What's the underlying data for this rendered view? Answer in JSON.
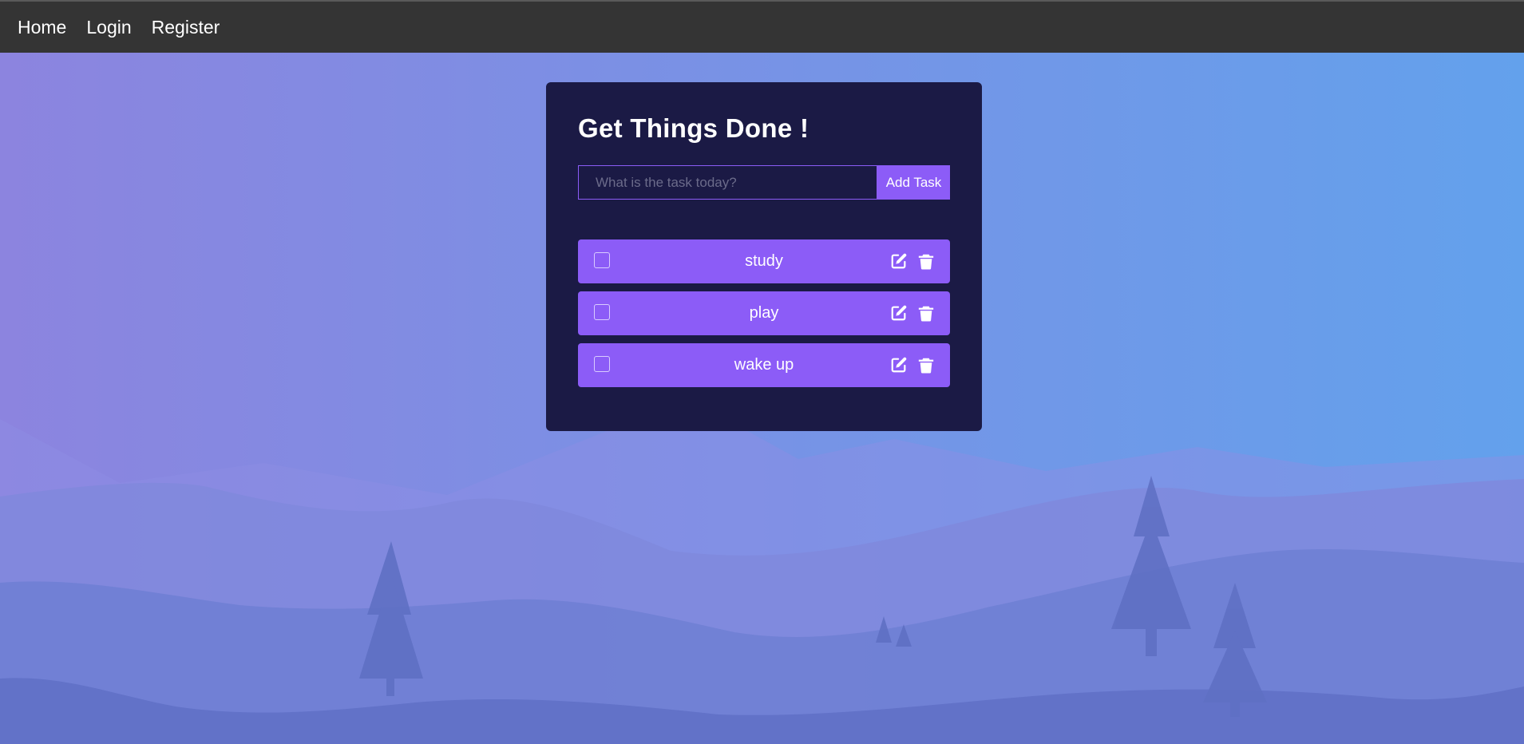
{
  "nav": {
    "links": [
      "Home",
      "Login",
      "Register"
    ]
  },
  "todo": {
    "title": "Get Things Done !",
    "input_placeholder": "What is the task today?",
    "input_value": "",
    "add_button_label": "Add Task",
    "tasks": [
      {
        "text": "study",
        "completed": false
      },
      {
        "text": "play",
        "completed": false
      },
      {
        "text": "wake up",
        "completed": false
      }
    ]
  },
  "icons": {
    "edit": "edit-icon",
    "delete": "trash-icon"
  },
  "colors": {
    "navbar": "#343434",
    "card": "#1b1a45",
    "accent": "#8c5cf7",
    "text": "#ffffff"
  }
}
